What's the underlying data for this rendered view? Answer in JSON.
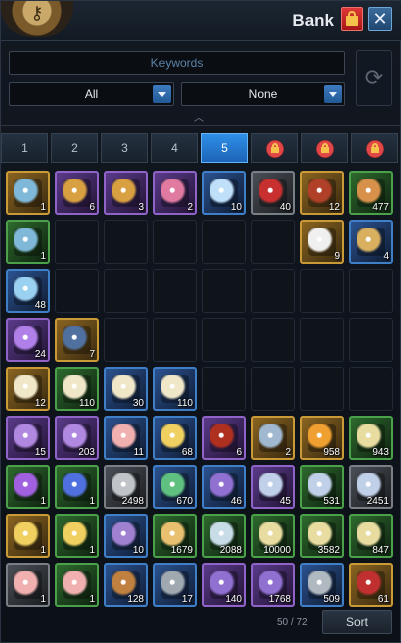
{
  "header": {
    "title": "Bank"
  },
  "search": {
    "placeholder": "Keywords"
  },
  "filters": {
    "category": "All",
    "sort_filter": "None"
  },
  "tabs": [
    {
      "label": "1",
      "locked": false,
      "active": false
    },
    {
      "label": "2",
      "locked": false,
      "active": false
    },
    {
      "label": "3",
      "locked": false,
      "active": false
    },
    {
      "label": "4",
      "locked": false,
      "active": false
    },
    {
      "label": "5",
      "locked": false,
      "active": true
    },
    {
      "label": "",
      "locked": true,
      "active": false
    },
    {
      "label": "",
      "locked": true,
      "active": false
    },
    {
      "label": "",
      "locked": true,
      "active": false
    }
  ],
  "colors": {
    "gold": "#c99a35",
    "purple": "#8f63c8",
    "blue": "#3f7fc7",
    "green": "#4aa14a",
    "grey": "#7a7f86",
    "active_tab": "#2f8fe6"
  },
  "slots": [
    [
      "gold:1:#7fb8d8",
      "purple:6:#d8a040",
      "purple:3:#d8a040",
      "purple:2:#e07aa0",
      "blue:10:#bfe0f8",
      "grey:40:#c83030",
      "gold:12:#b04028",
      "green:477:#d8914a"
    ],
    [
      "green:1:#7fb8d8",
      "",
      "",
      "",
      "",
      "",
      "gold:9:#f0f0f0",
      "blue:4:#d8b060"
    ],
    [
      "blue:48:#9ad0f0",
      "",
      "",
      "",
      "",
      "",
      "",
      ""
    ],
    [
      "purple:24:#b080e8",
      "gold:7:#5070a0",
      "",
      "",
      "",
      "",
      "",
      ""
    ],
    [
      "gold:12:#f0e6c8",
      "green:110:#f0e6c8",
      "blue:30:#f0e6c8",
      "blue:110:#f0e6c8",
      "",
      "",
      "",
      ""
    ],
    [
      "purple:15:#b088e0",
      "purple:203:#b088e0",
      "blue:11:#f0b0b0",
      "blue:68:#f0d060",
      "purple:6:#b03020",
      "gold:2:#a0b8d0",
      "gold:958:#f0a030",
      "green:943:#e8dca0"
    ],
    [
      "green:1:#a060e0",
      "green:1:#5070e0",
      "grey:2498:#c0c4c8",
      "blue:670:#60c080",
      "blue:46:#9070d0",
      "purple:45:#c0d0e8",
      "green:531:#c0d0e8",
      "grey:2451:#c0d0e8"
    ],
    [
      "gold:1:#f0d060",
      "green:1:#f0d060",
      "blue:10:#a080d0",
      "green:1679:#e8c070",
      "green:2088:#c8dce8",
      "green:10000:#e8dca0",
      "green:3582:#e8dca0",
      "green:847:#e8dca0"
    ],
    [
      "grey:1:#f0b0b0",
      "green:1:#f0b0b0",
      "blue:128:#c08040",
      "blue:17:#a0a8b0",
      "purple:140:#9070d0",
      "purple:1768:#9070d0",
      "blue:509:#b0b8c0",
      "gold:61:#c03030"
    ]
  ],
  "footer": {
    "capacity": "50 / 72",
    "sort_label": "Sort"
  }
}
